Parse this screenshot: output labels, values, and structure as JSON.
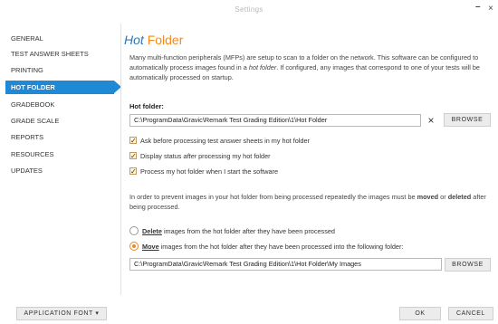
{
  "window": {
    "title": "Settings",
    "minimize": "–",
    "close": "×"
  },
  "sidebar": {
    "items": [
      {
        "label": "GENERAL"
      },
      {
        "label": "TEST ANSWER SHEETS"
      },
      {
        "label": "PRINTING"
      },
      {
        "label": "HOT FOLDER"
      },
      {
        "label": "GRADEBOOK"
      },
      {
        "label": "GRADE SCALE"
      },
      {
        "label": "REPORTS"
      },
      {
        "label": "RESOURCES"
      },
      {
        "label": "UPDATES"
      }
    ],
    "active_index": 3
  },
  "page": {
    "title_main": "Hot",
    "title_accent": "Folder",
    "desc_1": "Many multi-function peripherals (MFPs) are setup to scan to a folder on the network. This software can be configured to automatically process images found in a",
    "desc_em": "hot folder",
    "desc_2": ". If configured, any images that correspond to one of your tests will be automatically processed on startup."
  },
  "hot_folder": {
    "label": "Hot folder:",
    "path": "C:\\ProgramData\\Gravic\\Remark Test Grading Edition\\1\\Hot Folder",
    "clear_icon": "×",
    "browse_label": "BROWSE"
  },
  "options": [
    {
      "label": "Ask before processing test answer sheets in my hot folder",
      "checked": true
    },
    {
      "label_pre": "Display status",
      "label_em": "after",
      "label_post": "processing my hot folder",
      "checked": true
    },
    {
      "label": "Process my hot folder when I start the software",
      "checked": true
    }
  ],
  "check_mark": "✓",
  "info": {
    "pre": "In order to prevent images in your hot folder from being processed repeatedly the images must be",
    "moved": "moved",
    "or": "or",
    "deleted": "deleted",
    "post": "after being processed."
  },
  "radios": {
    "delete_hl": "Delete",
    "delete_rest": "images from the hot folder after they have been processed",
    "delete_checked": false,
    "move_hl": "Move",
    "move_rest": "images from the hot folder after they have been processed into the following folder:",
    "move_checked": true
  },
  "move_folder": {
    "path": "C:\\ProgramData\\Gravic\\Remark Test Grading Edition\\1\\Hot Folder\\My Images",
    "browse_label": "BROWSE"
  },
  "footer": {
    "app_font_label": "APPLICATION FONT",
    "app_font_caret": "▾",
    "ok_label": "OK",
    "cancel_label": "CANCEL"
  },
  "colors": {
    "accent_blue": "#1f89d6",
    "accent_orange": "#f28a1d",
    "title_blue": "#2e76b8"
  }
}
